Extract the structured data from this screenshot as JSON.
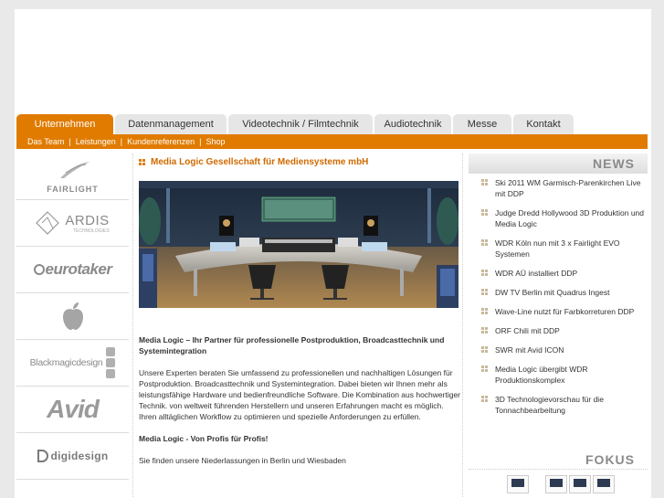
{
  "nav": {
    "tabs": [
      {
        "label": "Unternehmen",
        "active": true
      },
      {
        "label": "Datenmanagement",
        "active": false
      },
      {
        "label": "Videotechnik / Filmtechnik",
        "active": false
      },
      {
        "label": "Audiotechnik",
        "active": false
      },
      {
        "label": "Messe",
        "active": false
      },
      {
        "label": "Kontakt",
        "active": false
      }
    ],
    "subnav": [
      "Das Team",
      "Leistungen",
      "Kundenreferenzen",
      "Shop"
    ],
    "subnav_sep": "|"
  },
  "logos": {
    "fairlight": "FAIRLIGHT",
    "ardis": "ARDIS",
    "ardis_sub": "TECHNOLOGIES",
    "eurotaker": "eurotaker",
    "blackmagic": "Blackmagicdesign",
    "avid": "Avid",
    "digidesign": "digidesign"
  },
  "main": {
    "title": "Media Logic Gesellschaft für Mediensysteme mbH",
    "intro": "Media Logic – Ihr Partner für professionelle Postproduktion, Broadcasttechnik und Systemintegration",
    "body": "Unsere Experten beraten Sie umfassend zu professionellen und nachhaltigen Lösungen für Postproduktion. Broadcasttechnik und Systemintegration. Dabei bieten wir Ihnen mehr als leistungsfähige Hardware und bedienfreundliche Software. Die Kombination aus hochwertiger Technik. von weltweit führenden Herstellern und unseren Erfahrungen macht es möglich. Ihren alltäglichen Workflow zu optimieren und spezielle Anforderungen zu erfüllen.",
    "slogan": "Media Logic - Von Profis für Profis!",
    "locations": "Sie finden unsere Niederlassungen in Berlin und Wiesbaden"
  },
  "news": {
    "heading": "NEWS",
    "items": [
      "Ski 2011 WM Garmisch-Parenkirchen Live mit DDP",
      "Judge Dredd Hollywood 3D Produktion und Media Logic",
      "WDR Köln nun mit 3 x Fairlight EVO Systemen",
      "WDR AÜ installiert DDP",
      "DW TV Berlin mit Quadrus Ingest",
      "Wave-Line nutzt für Farbkorreturen DDP",
      "ORF Chili mit DDP",
      "SWR mit Avid ICON",
      "Media Logic übergibt WDR Produktionskomplex",
      "3D Technologievorschau für die Tonnachbearbeitung"
    ]
  },
  "fokus": {
    "heading": "FOKUS"
  },
  "colors": {
    "accent": "#e07b00",
    "heading_orange": "#d06a00"
  }
}
